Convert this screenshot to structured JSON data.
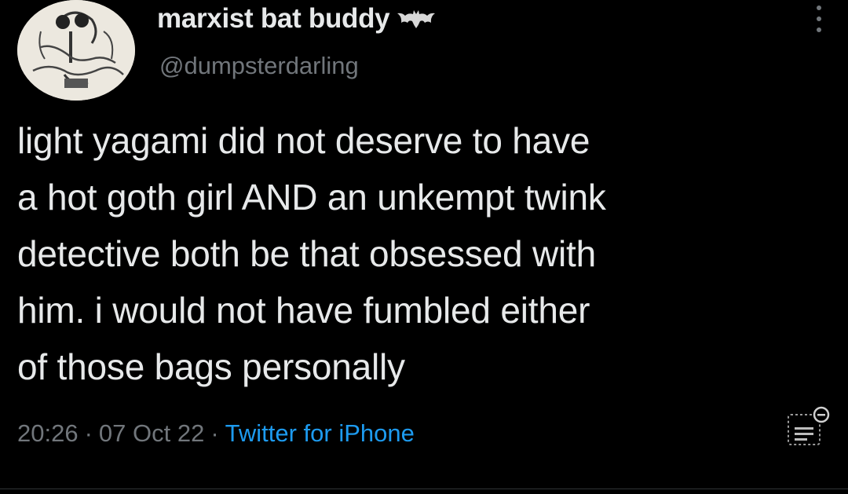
{
  "tweet": {
    "display_name": "marxist bat buddy",
    "badge_icon": "bat-icon",
    "handle": "@dumpsterdarling",
    "text": "light yagami did not deserve to have\na hot goth girl AND an unkempt twink\ndetective both be that obsessed with\nhim. i would not have fumbled either\nof those bags personally",
    "time": "20:26",
    "date": "07 Oct 22",
    "separator": "·",
    "source": "Twitter for iPhone"
  },
  "icons": {
    "more": "more-vertical-icon",
    "analytics": "analytics-icon"
  },
  "colors": {
    "background": "#000000",
    "text": "#e7e9ea",
    "secondary": "#71767b",
    "link": "#1d9bf0"
  }
}
